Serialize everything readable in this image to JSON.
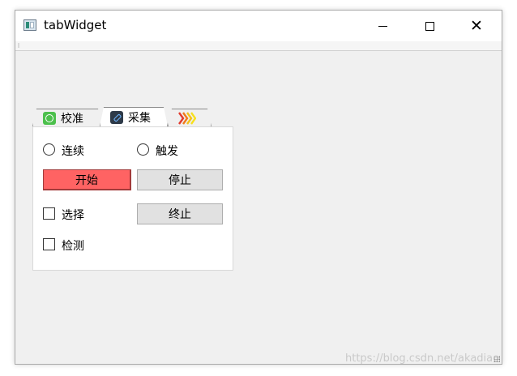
{
  "window": {
    "title": "tabWidget",
    "close_glyph": "✕"
  },
  "tabs": [
    {
      "label": "校准",
      "icon": "globe-icon"
    },
    {
      "label": "采集",
      "icon": "link-icon"
    },
    {
      "label": "",
      "icon": "chevrons-icon"
    }
  ],
  "panel": {
    "radio_continuous": "连续",
    "radio_trigger": "触发",
    "start_button": "开始",
    "stop_button": "停止",
    "end_button": "终止",
    "check_select": "选择",
    "check_detect": "检测"
  },
  "colors": {
    "start_button": "#ff6363",
    "tab_icon_green": "#4cc04c"
  },
  "watermark": "https://blog.csdn.net/akadiao"
}
